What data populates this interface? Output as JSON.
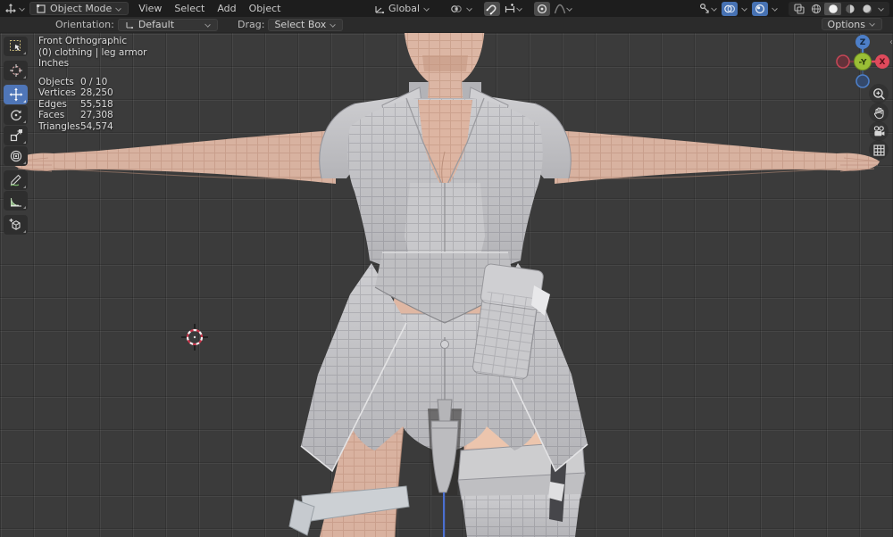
{
  "topbar": {
    "mode_dropdown": {
      "label": "Object Mode"
    },
    "menus": [
      {
        "label": "View"
      },
      {
        "label": "Select"
      },
      {
        "label": "Add"
      },
      {
        "label": "Object"
      }
    ],
    "transform_orientation": {
      "label": "Global"
    }
  },
  "tool_settings": {
    "orientation_label": "Orientation:",
    "orientation_value": "Default",
    "drag_label": "Drag:",
    "drag_value": "Select Box",
    "options_label": "Options"
  },
  "toolbar": {
    "active_tool": "move",
    "tools": [
      "select-box",
      "cursor",
      "move",
      "rotate",
      "scale",
      "transform",
      "annotate",
      "measure",
      "add-cube"
    ]
  },
  "viewport_overlay": {
    "view_name": "Front Orthographic",
    "active_collection": "(0) clothing | leg armor",
    "units": "Inches",
    "stats": [
      {
        "label": "Objects",
        "value": "0 / 10"
      },
      {
        "label": "Vertices",
        "value": "28,250"
      },
      {
        "label": "Edges",
        "value": "55,518"
      },
      {
        "label": "Faces",
        "value": "27,308"
      },
      {
        "label": "Triangles",
        "value": "54,574"
      }
    ]
  },
  "axis_gizmo": {
    "z_label": "Z",
    "x_label": "X",
    "front_label": "-Y",
    "x_color": "#e04a5c",
    "y_color": "#9abf36",
    "z_color": "#4d7fc8"
  },
  "colors": {
    "accent_blue": "#4f76b8",
    "header_bg": "#1d1d1d",
    "tool_settings_bg": "#2b2b2b",
    "viewport_bg": "#3b3b3b",
    "skin": "#d9b3a0",
    "cloth": "#c5c5c8"
  }
}
